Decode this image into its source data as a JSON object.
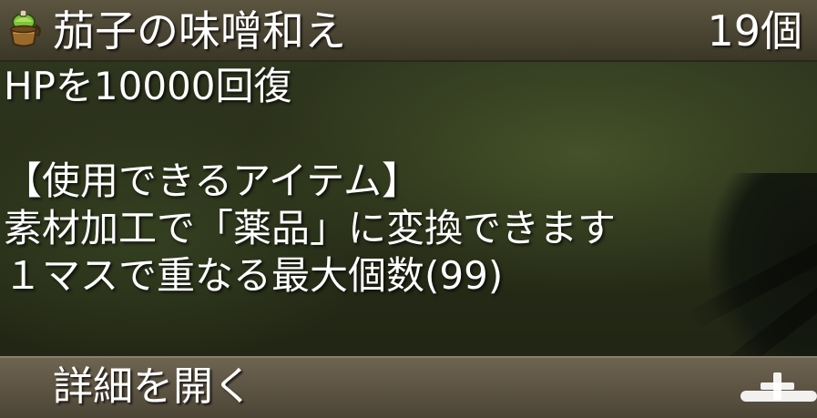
{
  "item": {
    "icon": "green-pot-food-icon",
    "name": "茄子の味噌和え",
    "count": "19個"
  },
  "description": {
    "effect": "HPを10000回復",
    "category": "【使用できるアイテム】",
    "processing": "素材加工で「薬品」に変換できます",
    "stack": "１マスで重なる最大個数(99)"
  },
  "footer": {
    "details_label": "詳細を開く",
    "expand_icon": "plus-icon"
  }
}
